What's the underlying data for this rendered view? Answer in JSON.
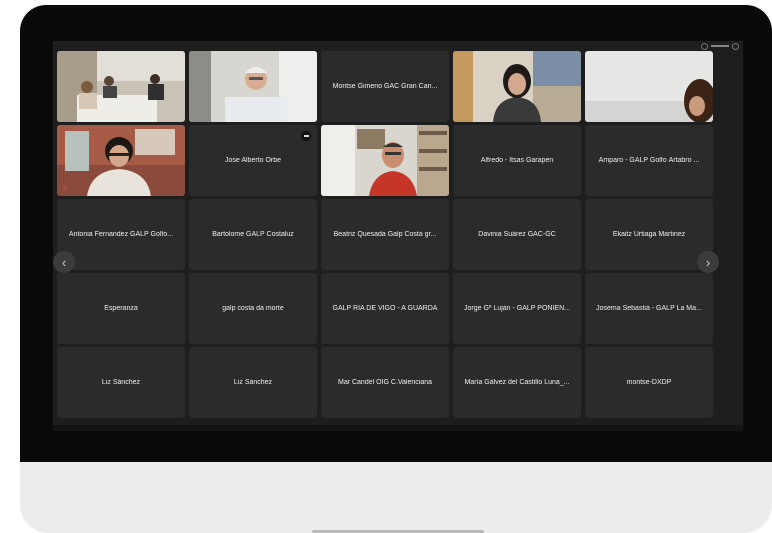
{
  "meeting": {
    "tiles": [
      {
        "name": "",
        "video": "group-room"
      },
      {
        "name": "",
        "video": "man-white-hair"
      },
      {
        "name": "Montse Gimeno GAC Gran Can..."
      },
      {
        "name": "",
        "video": "woman-dark-hair"
      },
      {
        "name": "",
        "video": "woman-corner"
      },
      {
        "name": "",
        "video": "woman-glasses"
      },
      {
        "name": "Jose Alberto Orbe",
        "muted": true
      },
      {
        "name": "",
        "video": "man-red-shirt"
      },
      {
        "name": "Alfredo - Itsas Garapen"
      },
      {
        "name": "Amparo - GALP Golfo Ártabro ..."
      },
      {
        "name": "Antonia Fernandez GALP Golfo..."
      },
      {
        "name": "Bartolome GALP Costaluz"
      },
      {
        "name": "Beatriz Quesada Galp Costa gr..."
      },
      {
        "name": "Davinia Suárez GAC-GC"
      },
      {
        "name": "Ekaitz Urtiaga Martinez"
      },
      {
        "name": "Esperanza"
      },
      {
        "name": "galp costa da morte"
      },
      {
        "name": "GALP RÍA DE VIGO - A GUARDA"
      },
      {
        "name": "Jorge Gª Luján - GALP PONIEN..."
      },
      {
        "name": "Josema Sebastiá - GALP La Ma..."
      },
      {
        "name": "Liz Sánchez"
      },
      {
        "name": "Liz Sánchez"
      },
      {
        "name": "Mar Candel OIG C.Valenciana"
      },
      {
        "name": "María Gálvez del Castillo Luna_..."
      },
      {
        "name": "montse-DXDP"
      }
    ],
    "nav": {
      "prev_glyph": "‹",
      "next_glyph": "›"
    },
    "speaking_mark": "3"
  },
  "colors": {
    "tile": "#2b2b2b",
    "screen": "#1e1e1e",
    "bezel": "#0a0a0a",
    "chin": "#ececec"
  }
}
